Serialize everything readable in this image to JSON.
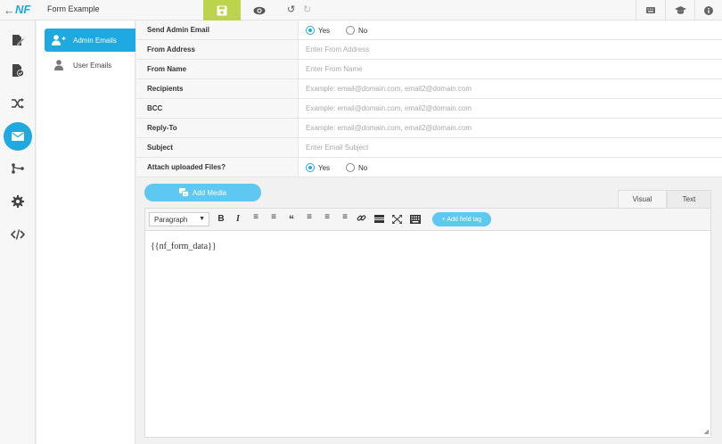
{
  "topbar": {
    "logo": "NF",
    "form_title": "Form Example",
    "back_icon": "arrow-left-icon",
    "save_icon": "floppy-disk-icon",
    "preview_icon": "eye-icon",
    "undo_icon": "undo-icon",
    "redo_icon": "redo-icon",
    "right_icons": [
      "keyboard-icon",
      "graduation-cap-icon",
      "info-icon"
    ],
    "accent": "#bcd44b"
  },
  "sidebar": {
    "items": [
      {
        "icon": "edit-form-icon"
      },
      {
        "icon": "file-check-icon"
      },
      {
        "icon": "shuffle-icon"
      },
      {
        "icon": "envelope-icon",
        "active": true
      },
      {
        "icon": "branch-icon"
      },
      {
        "icon": "gear-icon"
      },
      {
        "icon": "code-icon"
      }
    ],
    "active_color": "#1ea9e1"
  },
  "actions": {
    "items": [
      {
        "label": "Admin Emails",
        "active": true
      },
      {
        "label": "User Emails",
        "active": false
      }
    ]
  },
  "settings": {
    "send_admin_email": {
      "label": "Send Admin Email",
      "options": [
        "Yes",
        "No"
      ],
      "selected": "Yes"
    },
    "from_address": {
      "label": "From Address",
      "placeholder": "Enter From Address"
    },
    "from_name": {
      "label": "From Name",
      "placeholder": "Enter From Name"
    },
    "recipients": {
      "label": "Recipients",
      "placeholder": "Example: email@domain.com, email2@domain.com"
    },
    "bcc": {
      "label": "BCC",
      "placeholder": "Example: email@domain.com, email2@domain.com"
    },
    "reply_to": {
      "label": "Reply-To",
      "placeholder": "Example: email@domain.com, email2@domain.com"
    },
    "subject": {
      "label": "Subject",
      "placeholder": "Enter Email Subject"
    },
    "attach_files": {
      "label": "Attach uploaded Files?",
      "options": [
        "Yes",
        "No"
      ],
      "selected": "Yes"
    }
  },
  "editor": {
    "add_media_label": "Add Media",
    "tabs": [
      "Visual",
      "Text"
    ],
    "format_select": "Paragraph",
    "add_field_tag_label": "+ Add field tag",
    "content": "{{nf_form_data}}"
  }
}
